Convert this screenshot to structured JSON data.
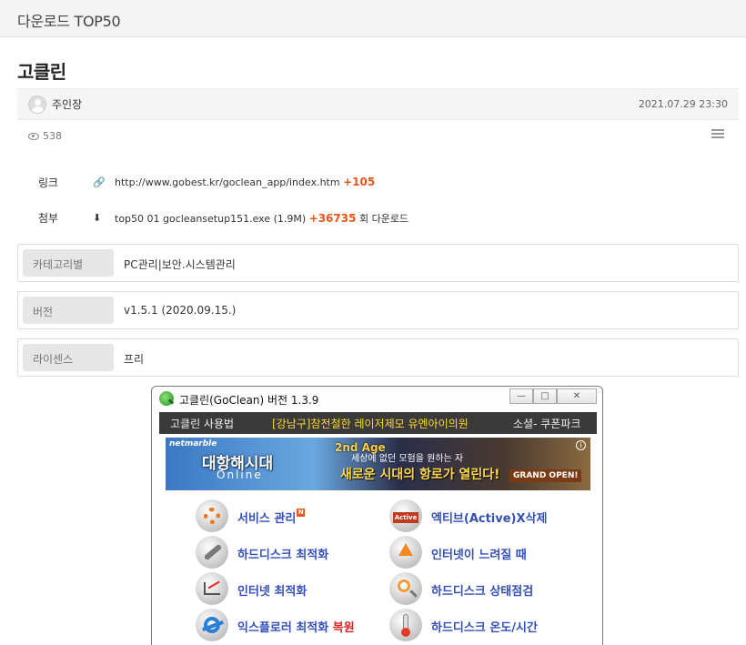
{
  "header": {
    "title": "다운로드 TOP50"
  },
  "post": {
    "title": "고클린",
    "author": "주인장",
    "date": "2021.07.29 23:30",
    "views": "538"
  },
  "link": {
    "label": "링크",
    "url": "http://www.gobest.kr/goclean_app/index.htm",
    "count": "+105"
  },
  "attachment": {
    "label": "첨부",
    "filename": "top50 01 gocleansetup151.exe (1.9M)",
    "count": "+36735",
    "suffix": "회 다운로드"
  },
  "properties": [
    {
      "key": "카테고리별",
      "value": "PC관리|보안.시스템관리"
    },
    {
      "key": "버전",
      "value": "v1.5.1 (2020.09.15.)"
    },
    {
      "key": "라이센스",
      "value": "프리"
    }
  ],
  "app": {
    "title": "고클린(GoClean) 버전 1.3.9",
    "window_buttons": {
      "minimize": "—",
      "maximize": "□",
      "close": "✕"
    },
    "menu": {
      "usage": "고클린 사용법",
      "ad": "[강남구]참전철한 레이저제모 유엔아이의원",
      "social": "소셜- 쿠폰파크"
    },
    "banner": {
      "brand": "netmarble",
      "game": "대항해시대",
      "game_sub": "Online",
      "edition": "2nd Age",
      "slogan_small": "세상에 없던 모험을 원하는 자",
      "slogan_big": "새로운 시대의 항로가 열린다!",
      "cta": "GRAND OPEN!",
      "info": "i"
    },
    "features": [
      {
        "label": "서비스 관리",
        "badge": "N",
        "icon": "gear-icon"
      },
      {
        "label": "엑티브(Active)X삭제",
        "icon": "activex-icon"
      },
      {
        "label": "하드디스크 최적화",
        "icon": "wrench-icon"
      },
      {
        "label": "인터넷이 느려질 때",
        "icon": "upload-arrow-icon"
      },
      {
        "label": "인터넷 최적화",
        "icon": "network-chart-icon"
      },
      {
        "label": "하드디스크 상태점검",
        "icon": "magnifier-icon"
      },
      {
        "label": "익스플로러 최적화",
        "extra": "복원",
        "icon": "ie-icon"
      },
      {
        "label": "하드디스크 온도/시간",
        "icon": "thermometer-icon"
      }
    ]
  },
  "colors": {
    "accent": "#e8561c",
    "feature_text": "#3350b8",
    "menu_bg": "#3a3a3a",
    "menu_highlight": "#ffd92f"
  }
}
